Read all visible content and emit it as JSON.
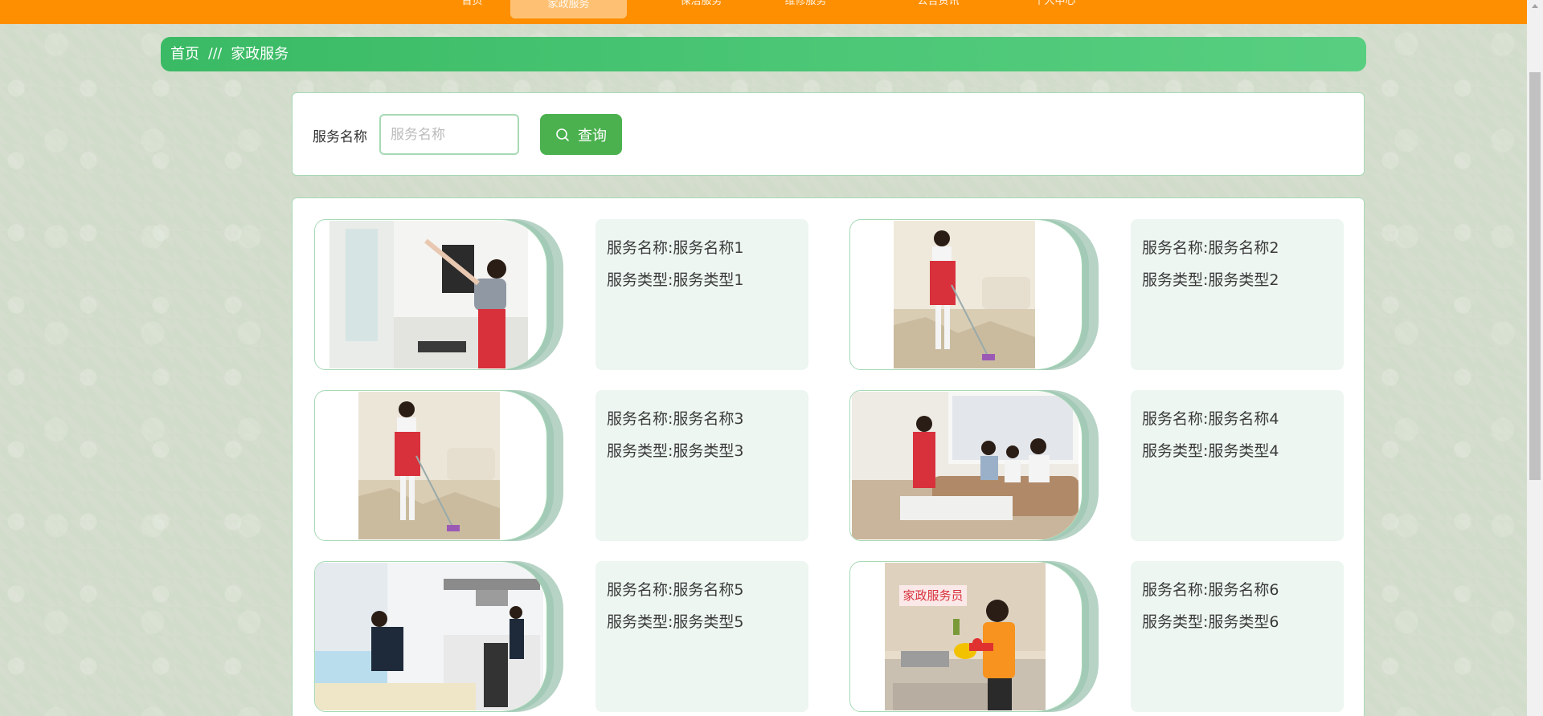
{
  "nav": {
    "items": [
      "首页",
      "家政服务",
      "保洁服务",
      "维修服务",
      "公告资讯",
      "个人中心"
    ]
  },
  "breadcrumb": {
    "home": "首页",
    "separator": "///",
    "current": "家政服务"
  },
  "search": {
    "label": "服务名称",
    "placeholder": "服务名称",
    "value": "",
    "button_label": "查询",
    "button_icon": "search-icon"
  },
  "services": [
    {
      "name_line": "服务名称:服务名称1",
      "type_line": "服务类型:服务类型1"
    },
    {
      "name_line": "服务名称:服务名称2",
      "type_line": "服务类型:服务类型2"
    },
    {
      "name_line": "服务名称:服务名称3",
      "type_line": "服务类型:服务类型3"
    },
    {
      "name_line": "服务名称:服务名称4",
      "type_line": "服务类型:服务类型4"
    },
    {
      "name_line": "服务名称:服务名称5",
      "type_line": "服务类型:服务类型5"
    },
    {
      "name_line": "服务名称:服务名称6",
      "type_line": "服务类型:服务类型6"
    }
  ],
  "photo_badge": "家政服务员",
  "colors": {
    "nav_bar": "#fe8f00",
    "breadcrumb": "#4bc776",
    "button": "#4bb14f",
    "card_border": "#a7d9b5",
    "info_bg": "#edf6f0"
  }
}
